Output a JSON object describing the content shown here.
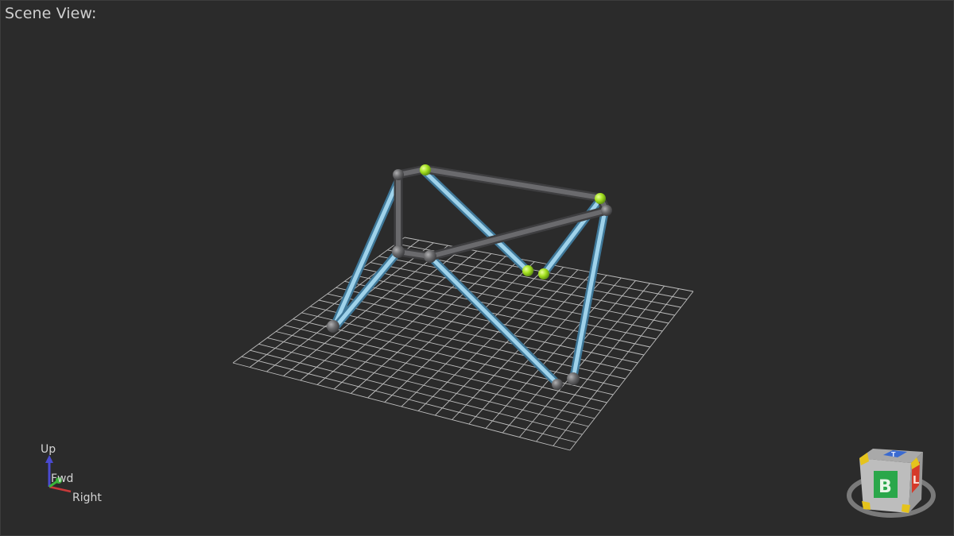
{
  "viewport": {
    "title": "Scene View:"
  },
  "axes_gizmo": {
    "up_label": "Up",
    "forward_label": "Fwd",
    "right_label": "Right"
  },
  "view_cube": {
    "front_label": "B",
    "side_label": "L",
    "top_label": "T"
  },
  "colors": {
    "background": "#2b2b2b",
    "grid": "#d8d8d8",
    "beam_blue": "#7ab8d6",
    "beam_gray": "#555558",
    "node_gray": "#6a6a6c",
    "node_green": "#a4e020",
    "cube_face_green": "#2aa74a",
    "cube_face_red": "#d53a2a",
    "cube_corner_yellow": "#e5c31c"
  }
}
